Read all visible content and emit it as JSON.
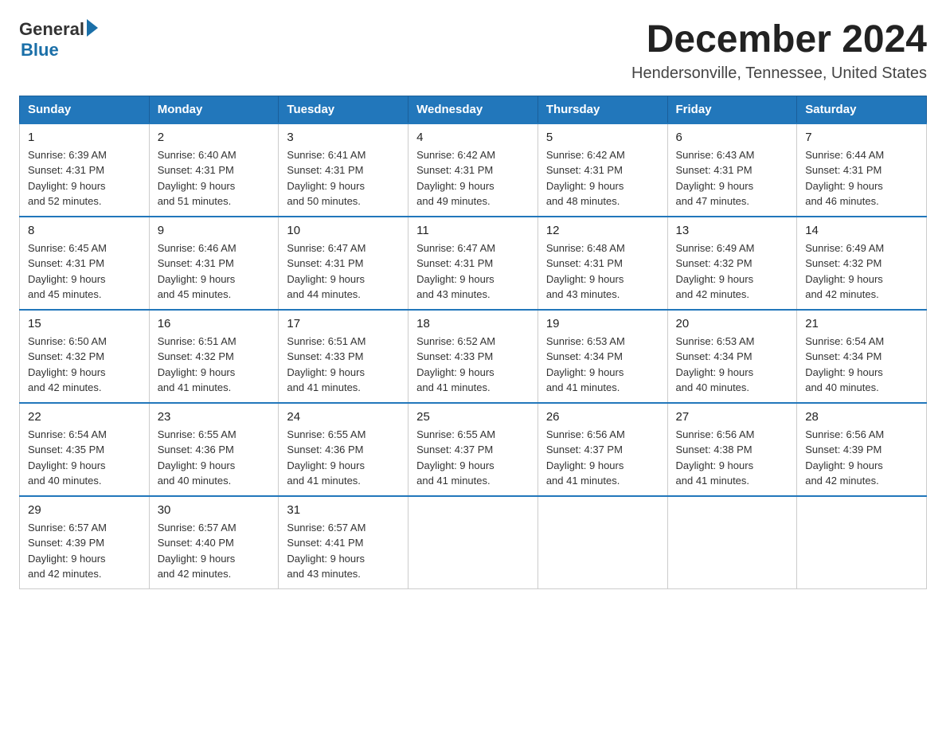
{
  "header": {
    "logo_general": "General",
    "logo_blue": "Blue",
    "month_title": "December 2024",
    "location": "Hendersonville, Tennessee, United States"
  },
  "weekdays": [
    "Sunday",
    "Monday",
    "Tuesday",
    "Wednesday",
    "Thursday",
    "Friday",
    "Saturday"
  ],
  "weeks": [
    [
      {
        "day": "1",
        "sunrise": "6:39 AM",
        "sunset": "4:31 PM",
        "daylight": "9 hours and 52 minutes."
      },
      {
        "day": "2",
        "sunrise": "6:40 AM",
        "sunset": "4:31 PM",
        "daylight": "9 hours and 51 minutes."
      },
      {
        "day": "3",
        "sunrise": "6:41 AM",
        "sunset": "4:31 PM",
        "daylight": "9 hours and 50 minutes."
      },
      {
        "day": "4",
        "sunrise": "6:42 AM",
        "sunset": "4:31 PM",
        "daylight": "9 hours and 49 minutes."
      },
      {
        "day": "5",
        "sunrise": "6:42 AM",
        "sunset": "4:31 PM",
        "daylight": "9 hours and 48 minutes."
      },
      {
        "day": "6",
        "sunrise": "6:43 AM",
        "sunset": "4:31 PM",
        "daylight": "9 hours and 47 minutes."
      },
      {
        "day": "7",
        "sunrise": "6:44 AM",
        "sunset": "4:31 PM",
        "daylight": "9 hours and 46 minutes."
      }
    ],
    [
      {
        "day": "8",
        "sunrise": "6:45 AM",
        "sunset": "4:31 PM",
        "daylight": "9 hours and 45 minutes."
      },
      {
        "day": "9",
        "sunrise": "6:46 AM",
        "sunset": "4:31 PM",
        "daylight": "9 hours and 45 minutes."
      },
      {
        "day": "10",
        "sunrise": "6:47 AM",
        "sunset": "4:31 PM",
        "daylight": "9 hours and 44 minutes."
      },
      {
        "day": "11",
        "sunrise": "6:47 AM",
        "sunset": "4:31 PM",
        "daylight": "9 hours and 43 minutes."
      },
      {
        "day": "12",
        "sunrise": "6:48 AM",
        "sunset": "4:31 PM",
        "daylight": "9 hours and 43 minutes."
      },
      {
        "day": "13",
        "sunrise": "6:49 AM",
        "sunset": "4:32 PM",
        "daylight": "9 hours and 42 minutes."
      },
      {
        "day": "14",
        "sunrise": "6:49 AM",
        "sunset": "4:32 PM",
        "daylight": "9 hours and 42 minutes."
      }
    ],
    [
      {
        "day": "15",
        "sunrise": "6:50 AM",
        "sunset": "4:32 PM",
        "daylight": "9 hours and 42 minutes."
      },
      {
        "day": "16",
        "sunrise": "6:51 AM",
        "sunset": "4:32 PM",
        "daylight": "9 hours and 41 minutes."
      },
      {
        "day": "17",
        "sunrise": "6:51 AM",
        "sunset": "4:33 PM",
        "daylight": "9 hours and 41 minutes."
      },
      {
        "day": "18",
        "sunrise": "6:52 AM",
        "sunset": "4:33 PM",
        "daylight": "9 hours and 41 minutes."
      },
      {
        "day": "19",
        "sunrise": "6:53 AM",
        "sunset": "4:34 PM",
        "daylight": "9 hours and 41 minutes."
      },
      {
        "day": "20",
        "sunrise": "6:53 AM",
        "sunset": "4:34 PM",
        "daylight": "9 hours and 40 minutes."
      },
      {
        "day": "21",
        "sunrise": "6:54 AM",
        "sunset": "4:34 PM",
        "daylight": "9 hours and 40 minutes."
      }
    ],
    [
      {
        "day": "22",
        "sunrise": "6:54 AM",
        "sunset": "4:35 PM",
        "daylight": "9 hours and 40 minutes."
      },
      {
        "day": "23",
        "sunrise": "6:55 AM",
        "sunset": "4:36 PM",
        "daylight": "9 hours and 40 minutes."
      },
      {
        "day": "24",
        "sunrise": "6:55 AM",
        "sunset": "4:36 PM",
        "daylight": "9 hours and 41 minutes."
      },
      {
        "day": "25",
        "sunrise": "6:55 AM",
        "sunset": "4:37 PM",
        "daylight": "9 hours and 41 minutes."
      },
      {
        "day": "26",
        "sunrise": "6:56 AM",
        "sunset": "4:37 PM",
        "daylight": "9 hours and 41 minutes."
      },
      {
        "day": "27",
        "sunrise": "6:56 AM",
        "sunset": "4:38 PM",
        "daylight": "9 hours and 41 minutes."
      },
      {
        "day": "28",
        "sunrise": "6:56 AM",
        "sunset": "4:39 PM",
        "daylight": "9 hours and 42 minutes."
      }
    ],
    [
      {
        "day": "29",
        "sunrise": "6:57 AM",
        "sunset": "4:39 PM",
        "daylight": "9 hours and 42 minutes."
      },
      {
        "day": "30",
        "sunrise": "6:57 AM",
        "sunset": "4:40 PM",
        "daylight": "9 hours and 42 minutes."
      },
      {
        "day": "31",
        "sunrise": "6:57 AM",
        "sunset": "4:41 PM",
        "daylight": "9 hours and 43 minutes."
      },
      null,
      null,
      null,
      null
    ]
  ],
  "labels": {
    "sunrise": "Sunrise:",
    "sunset": "Sunset:",
    "daylight": "Daylight:"
  }
}
